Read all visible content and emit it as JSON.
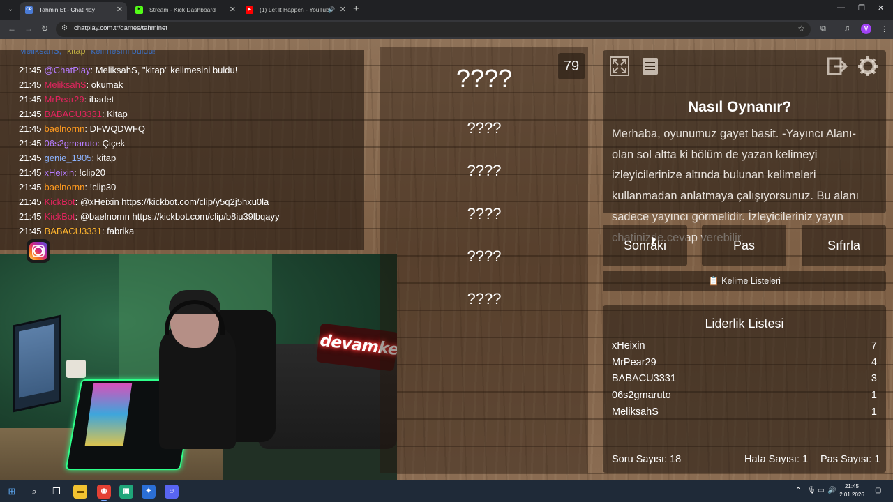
{
  "browser": {
    "tabs": [
      {
        "title": "Tahmin Et - ChatPlay",
        "favicon": "CP",
        "favicon_color": "#4a7bd6",
        "active": true
      },
      {
        "title": "Stream - Kick Dashboard",
        "favicon": "K",
        "favicon_color": "#53fc18",
        "active": false
      },
      {
        "title": "(1) Let It Happen - YouTube",
        "favicon": "▶",
        "favicon_color": "#ff0000",
        "active": false
      }
    ],
    "url": "chatplay.com.tr/games/tahminet",
    "profile_initial": "V"
  },
  "chat": {
    "top_partial": {
      "user": "MeliksahS",
      "word": "\"kitap\"",
      "text": "kelimesini buldu!"
    },
    "lines": [
      {
        "time": "21:45",
        "user": "@ChatPlay",
        "color": "#b57cff",
        "text": ": MeliksahS, \"kitap\" kelimesini buldu!"
      },
      {
        "time": "21:45",
        "user": "MeliksahS",
        "color": "#e0245e",
        "text": ": okumak"
      },
      {
        "time": "21:45",
        "user": "MrPear29",
        "color": "#e0245e",
        "text": ": ibadet"
      },
      {
        "time": "21:45",
        "user": "BABACU3331",
        "color": "#e0245e",
        "text": ": Kitap"
      },
      {
        "time": "21:45",
        "user": "baelnornn",
        "color": "#ff9a1f",
        "text": ": DFWQDWFQ"
      },
      {
        "time": "21:45",
        "user": "06s2gmaruto",
        "color": "#b57cff",
        "text": ": Çiçek"
      },
      {
        "time": "21:45",
        "user": "genie_1905",
        "color": "#8db4ff",
        "text": ": kitap"
      },
      {
        "time": "21:45",
        "user": "xHeixin",
        "color": "#b57cff",
        "text": ": !clip20"
      },
      {
        "time": "21:45",
        "user": "baelnornn",
        "color": "#ff9a1f",
        "text": ": !clip30"
      },
      {
        "time": "21:45",
        "user": "KickBot",
        "color": "#e0245e",
        "text": ": @xHeixin https://kickbot.com/clip/y5q2j5hxu0la"
      },
      {
        "time": "21:45",
        "user": "KickBot",
        "color": "#e0245e",
        "text": ": @baelnornn https://kickbot.com/clip/b8iu39lbqayy"
      },
      {
        "time": "21:45",
        "user": "BABACU3331",
        "color": "#ffb52e",
        "text": ": fabrika"
      }
    ]
  },
  "webcam": {
    "neon_sign": "devamke lo"
  },
  "game": {
    "counter": "79",
    "main_word": "????",
    "words": [
      "????",
      "????",
      "????",
      "????",
      "????"
    ]
  },
  "howto": {
    "title": "Nasıl Oynanır?",
    "text": "Merhaba, oyunumuz gayet basit. -Yayıncı Alanı- olan sol altta ki bölüm de yazan kelimeyi izleyicilerinize altında bulunan kelimeleri kullanmadan anlatmaya çalışıyorsunuz. Bu alanı sadece yayıncı görmelidir. İzleyicileriniz yayın chatinizde cevap verebilir."
  },
  "actions": {
    "next": "Sonraki",
    "pass": "Pas",
    "reset": "Sıfırla",
    "word_lists": "Kelime Listeleri"
  },
  "leaderboard": {
    "title": "Liderlik Listesi",
    "rows": [
      {
        "name": "xHeixin",
        "score": "7"
      },
      {
        "name": "MrPear29",
        "score": "4"
      },
      {
        "name": "BABACU3331",
        "score": "3"
      },
      {
        "name": "06s2gmaruto",
        "score": "1"
      },
      {
        "name": "MeliksahS",
        "score": "1"
      }
    ],
    "stats": {
      "questions": "Soru Sayısı: 18",
      "errors": "Hata Sayısı: 1",
      "passes": "Pas Sayısı: 1"
    }
  },
  "taskbar": {
    "time": "21:45",
    "date": "2.01.2026"
  }
}
